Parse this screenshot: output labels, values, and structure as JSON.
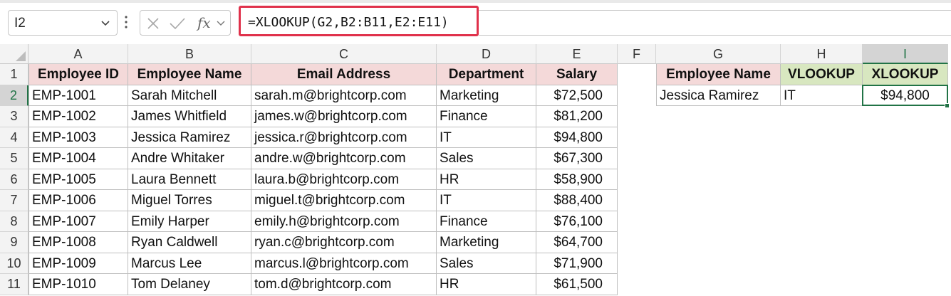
{
  "formula_bar": {
    "name_box": "I2",
    "fx_label": "fx",
    "formula": "=XLOOKUP(G2,B2:B11,E2:E11)"
  },
  "columns": [
    "A",
    "B",
    "C",
    "D",
    "E",
    "F",
    "G",
    "H",
    "I"
  ],
  "rows": [
    "1",
    "2",
    "3",
    "4",
    "5",
    "6",
    "7",
    "8",
    "9",
    "10",
    "11"
  ],
  "selected": {
    "column": "I",
    "row": "2"
  },
  "table": {
    "headers": [
      "Employee ID",
      "Employee Name",
      "Email Address",
      "Department",
      "Salary"
    ],
    "rows": [
      [
        "EMP-1001",
        "Sarah Mitchell",
        "sarah.m@brightcorp.com",
        "Marketing",
        "$72,500"
      ],
      [
        "EMP-1002",
        "James Whitfield",
        "james.w@brightcorp.com",
        "Finance",
        "$81,200"
      ],
      [
        "EMP-1003",
        "Jessica Ramirez",
        "jessica.r@brightcorp.com",
        "IT",
        "$94,800"
      ],
      [
        "EMP-1004",
        "Andre Whitaker",
        "andre.w@brightcorp.com",
        "Sales",
        "$67,300"
      ],
      [
        "EMP-1005",
        "Laura Bennett",
        "laura.b@brightcorp.com",
        "HR",
        "$58,900"
      ],
      [
        "EMP-1006",
        "Miguel Torres",
        "miguel.t@brightcorp.com",
        "IT",
        "$88,400"
      ],
      [
        "EMP-1007",
        "Emily Harper",
        "emily.h@brightcorp.com",
        "Finance",
        "$76,100"
      ],
      [
        "EMP-1008",
        "Ryan Caldwell",
        "ryan.c@brightcorp.com",
        "Marketing",
        "$64,700"
      ],
      [
        "EMP-1009",
        "Marcus Lee",
        "marcus.l@brightcorp.com",
        "Sales",
        "$71,900"
      ],
      [
        "EMP-1010",
        "Tom Delaney",
        "tom.d@brightcorp.com",
        "HR",
        "$61,500"
      ]
    ]
  },
  "lookup": {
    "headers": [
      "Employee Name",
      "VLOOKUP",
      "XLOOKUP"
    ],
    "values": [
      "Jessica Ramirez",
      "IT",
      "$94,800"
    ]
  },
  "colors": {
    "header_fill": "#f4d9d9",
    "lookup_fill": "#d8e7c0",
    "selection": "#217346",
    "formula_highlight": "#e0314b"
  }
}
